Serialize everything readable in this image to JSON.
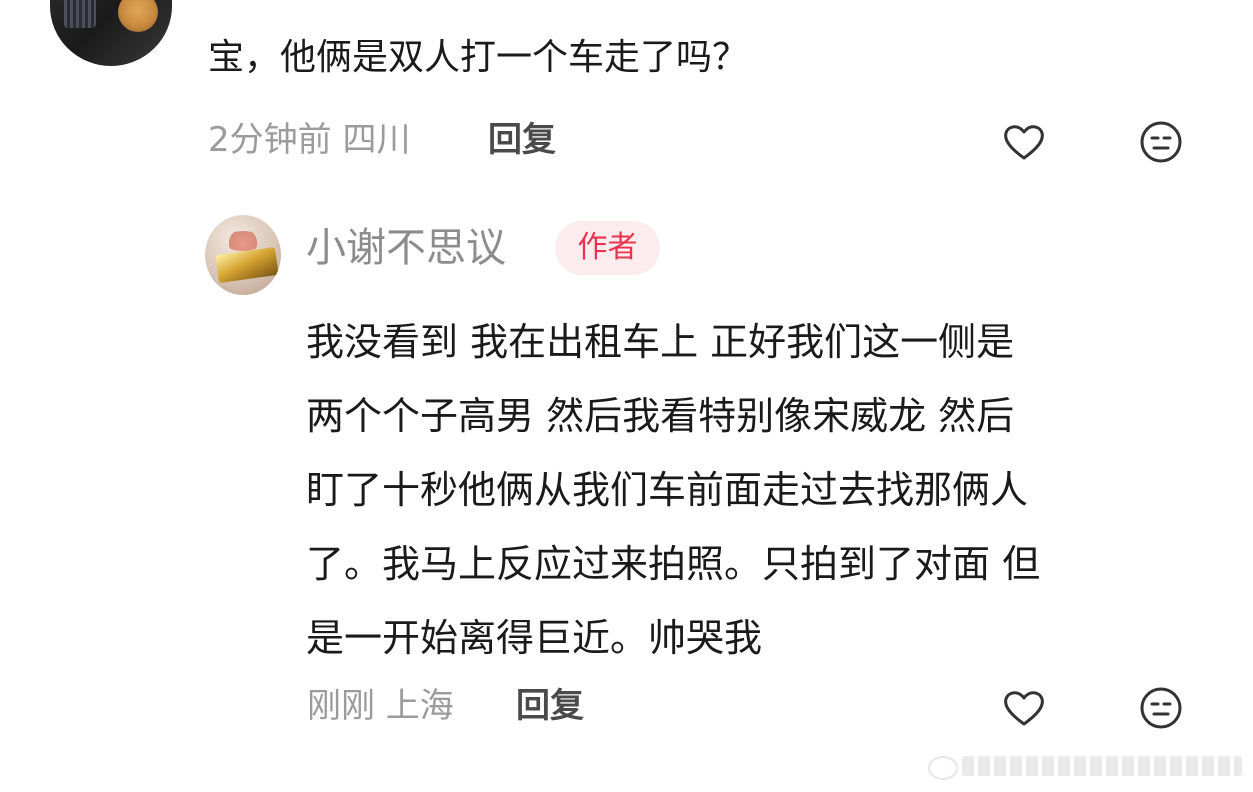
{
  "comment1": {
    "text": "宝，他俩是双人打一个车走了吗？",
    "meta": "2分钟前 四川",
    "reply_label": "回复",
    "like_icon": "heart-outline-icon",
    "dislike_icon": "neutral-face-icon"
  },
  "reply": {
    "author": "小谢不思议",
    "badge": "作者",
    "lines": [
      "我没看到 我在出租车上 正好我们这一侧是",
      "两个个子高男 然后我看特别像宋威龙 然后",
      "盯了十秒他俩从我们车前面走过去找那俩人",
      "了。我马上反应过来拍照。只拍到了对面 但",
      "是一开始离得巨近。帅哭我"
    ],
    "meta": "刚刚 上海",
    "reply_label": "回复",
    "like_icon": "heart-outline-icon",
    "dislike_icon": "neutral-face-icon"
  },
  "colors": {
    "text": "#1a1a1a",
    "meta": "#9b9b9b",
    "badge_text": "#e8344f",
    "badge_bg": "#fdecee"
  }
}
